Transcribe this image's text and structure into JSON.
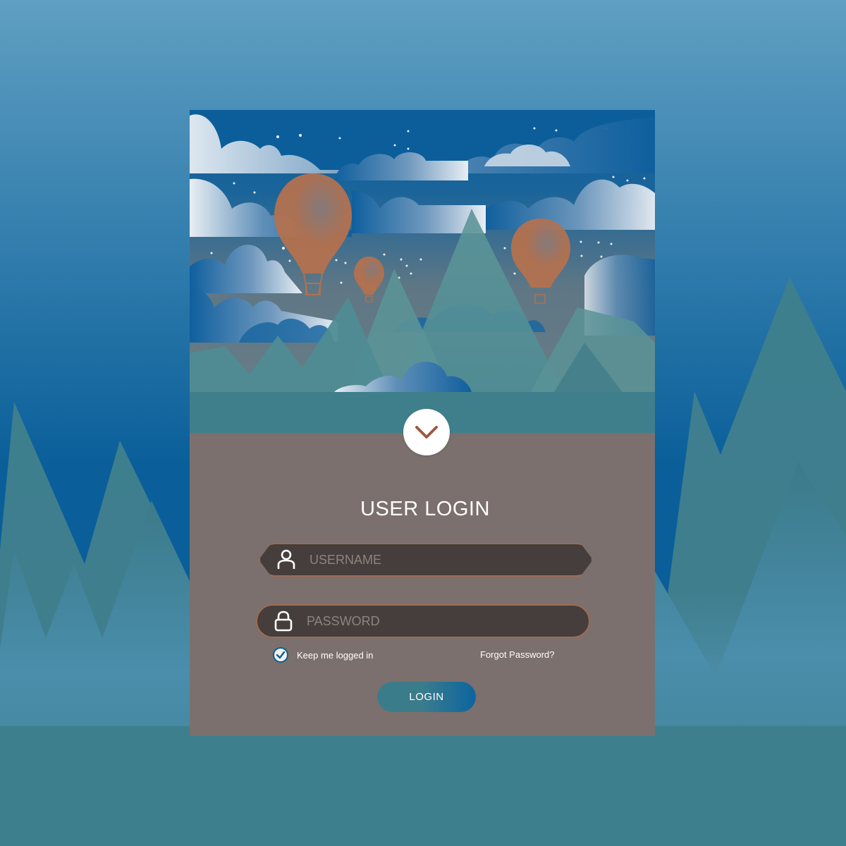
{
  "login": {
    "title": "USER LOGIN",
    "username_placeholder": "USERNAME",
    "password_placeholder": "PASSWORD",
    "remember_label": "Keep me logged in",
    "remember_checked": true,
    "forgot_label": "Forgot Password?",
    "login_label": "LOGIN"
  },
  "icons": {
    "toggle": "chevron-down-icon",
    "username": "user-icon",
    "password": "lock-icon",
    "remember": "check-icon"
  },
  "colors": {
    "sky_top": "#5f9fc2",
    "sky_bottom": "#0a5f9a",
    "mountain": "#3e7f8e",
    "panel": "#7b706d",
    "field": "#453e3c",
    "field_border": "#a06b52",
    "balloon": "#b3714f",
    "button_left": "#3b7c8b",
    "button_right": "#0c65a0"
  }
}
